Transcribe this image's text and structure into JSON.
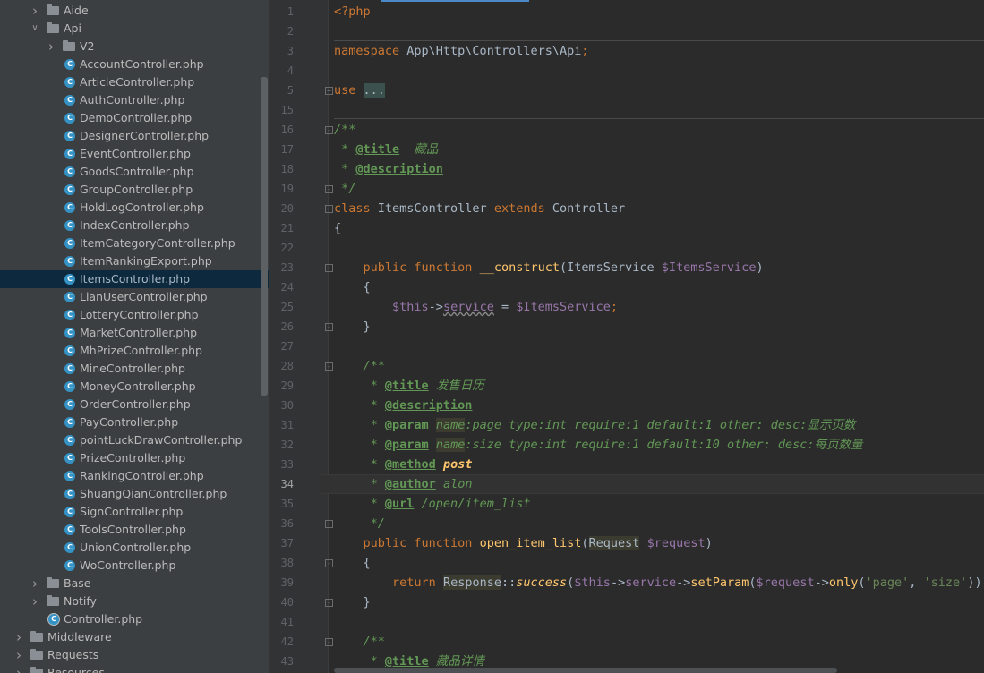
{
  "sidebar": {
    "tree": [
      {
        "label": "Aide",
        "kind": "folder",
        "level": 2,
        "expanded": false
      },
      {
        "label": "Api",
        "kind": "folder",
        "level": 2,
        "expanded": true
      },
      {
        "label": "V2",
        "kind": "folder",
        "level": 3,
        "expanded": false
      },
      {
        "label": "AccountController.php",
        "kind": "class",
        "level": 4
      },
      {
        "label": "ArticleController.php",
        "kind": "class",
        "level": 4
      },
      {
        "label": "AuthController.php",
        "kind": "class",
        "level": 4
      },
      {
        "label": "DemoController.php",
        "kind": "class",
        "level": 4
      },
      {
        "label": "DesignerController.php",
        "kind": "class",
        "level": 4
      },
      {
        "label": "EventController.php",
        "kind": "class",
        "level": 4
      },
      {
        "label": "GoodsController.php",
        "kind": "class",
        "level": 4
      },
      {
        "label": "GroupController.php",
        "kind": "class",
        "level": 4
      },
      {
        "label": "HoldLogController.php",
        "kind": "class",
        "level": 4
      },
      {
        "label": "IndexController.php",
        "kind": "class",
        "level": 4
      },
      {
        "label": "ItemCategoryController.php",
        "kind": "class",
        "level": 4
      },
      {
        "label": "ItemRankingExport.php",
        "kind": "class",
        "level": 4
      },
      {
        "label": "ItemsController.php",
        "kind": "class",
        "level": 4,
        "selected": true
      },
      {
        "label": "LianUserController.php",
        "kind": "class",
        "level": 4
      },
      {
        "label": "LotteryController.php",
        "kind": "class",
        "level": 4
      },
      {
        "label": "MarketController.php",
        "kind": "class",
        "level": 4
      },
      {
        "label": "MhPrizeController.php",
        "kind": "class",
        "level": 4
      },
      {
        "label": "MineController.php",
        "kind": "class",
        "level": 4
      },
      {
        "label": "MoneyController.php",
        "kind": "class",
        "level": 4
      },
      {
        "label": "OrderController.php",
        "kind": "class",
        "level": 4
      },
      {
        "label": "PayController.php",
        "kind": "class",
        "level": 4
      },
      {
        "label": "pointLuckDrawController.php",
        "kind": "class",
        "level": 4
      },
      {
        "label": "PrizeController.php",
        "kind": "class",
        "level": 4
      },
      {
        "label": "RankingController.php",
        "kind": "class",
        "level": 4
      },
      {
        "label": "ShuangQianController.php",
        "kind": "class",
        "level": 4
      },
      {
        "label": "SignController.php",
        "kind": "class",
        "level": 4
      },
      {
        "label": "ToolsController.php",
        "kind": "class",
        "level": 4
      },
      {
        "label": "UnionController.php",
        "kind": "class",
        "level": 4
      },
      {
        "label": "WoController.php",
        "kind": "class",
        "level": 4
      },
      {
        "label": "Base",
        "kind": "folder",
        "level": 2,
        "expanded": false
      },
      {
        "label": "Notify",
        "kind": "folder",
        "level": 2,
        "expanded": false
      },
      {
        "label": "Controller.php",
        "kind": "class-ring",
        "level": 3
      },
      {
        "label": "Middleware",
        "kind": "folder",
        "level": 1,
        "expanded": false
      },
      {
        "label": "Requests",
        "kind": "folder",
        "level": 1,
        "expanded": false
      },
      {
        "label": "Resources",
        "kind": "folder",
        "level": 1,
        "expanded": false
      }
    ]
  },
  "editor": {
    "current_line": "34",
    "lines": [
      {
        "n": "1",
        "html": "<span class='k'>&lt;?php</span>"
      },
      {
        "n": "2",
        "html": ""
      },
      {
        "n": "3",
        "html": "<span class='k'>namespace</span> App\\Http\\Controllers\\Api<span class='k'>;</span>"
      },
      {
        "n": "4",
        "html": ""
      },
      {
        "n": "5",
        "html": "<span class='k'>use</span> <span class='fmark'>...</span>"
      },
      {
        "n": "15",
        "html": ""
      },
      {
        "n": "16",
        "html": "<span class='c'>/**</span>"
      },
      {
        "n": "17",
        "html": "<span class='c'> * </span><span class='ct'>@title</span><span class='c'>  藏品</span>"
      },
      {
        "n": "18",
        "html": "<span class='c'> * </span><span class='ct'>@description</span>"
      },
      {
        "n": "19",
        "html": "<span class='c'> */</span>"
      },
      {
        "n": "20",
        "html": "<span class='k'>class</span> ItemsController <span class='k'>extends</span> Controller"
      },
      {
        "n": "21",
        "html": "{"
      },
      {
        "n": "22",
        "html": ""
      },
      {
        "n": "23",
        "html": "    <span class='k'>public function</span> <span class='f'>__construct</span>(ItemsService <span class='v'>$ItemsService</span>)"
      },
      {
        "n": "24",
        "html": "    {"
      },
      {
        "n": "25",
        "html": "        <span class='v'>$this</span>-&gt;<span class='v' style='text-decoration:underline wavy #8a8a8a'>service</span> = <span class='v'>$ItemsService</span><span class='k'>;</span>"
      },
      {
        "n": "26",
        "html": "    }"
      },
      {
        "n": "27",
        "html": ""
      },
      {
        "n": "28",
        "html": "    <span class='c'>/**</span>"
      },
      {
        "n": "29",
        "html": "<span class='c'>     * </span><span class='ct'>@title</span><span class='c'> 发售日历</span>"
      },
      {
        "n": "30",
        "html": "<span class='c'>     * </span><span class='ct'>@description</span>"
      },
      {
        "n": "31",
        "html": "<span class='c'>     * </span><span class='ct'>@param</span><span class='c'> </span><span class='c hl'>name</span><span class='c'>:page type:int require:1 default:1 other: desc:显示页数</span>"
      },
      {
        "n": "32",
        "html": "<span class='c'>     * </span><span class='ct'>@param</span><span class='c'> </span><span class='c hl'>name</span><span class='c'>:size type:int require:1 default:10 other: desc:每页数量</span>"
      },
      {
        "n": "33",
        "html": "<span class='c'>     * </span><span class='ct'>@method</span><span class='c'> </span><span class='fi' style='font-weight:bold'>post</span>"
      },
      {
        "n": "34",
        "html": "<span class='c'>     * </span><span class='ct'>@author</span><span class='c'> alon</span>"
      },
      {
        "n": "35",
        "html": "<span class='c'>     * </span><span class='ct'>@url</span><span class='c'> /open/item_list</span>"
      },
      {
        "n": "36",
        "html": "<span class='c'>     */</span>"
      },
      {
        "n": "37",
        "html": "    <span class='k'>public function</span> <span class='f'>open_item_list</span>(<span class='hl'>Request</span> <span class='v'>$request</span>)"
      },
      {
        "n": "38",
        "html": "    {"
      },
      {
        "n": "39",
        "html": "        <span class='k'>return</span> <span class='hl'>Response</span>::<span class='fi'>success</span>(<span class='v'>$this</span>-&gt;<span class='v'>service</span>-&gt;<span class='f'>setParam</span>(<span class='v'>$request</span>-&gt;<span class='f'>only</span>(<span class='s'>'page'</span>, <span class='s'>'size'</span>))-&gt;"
      },
      {
        "n": "40",
        "html": "    }"
      },
      {
        "n": "41",
        "html": ""
      },
      {
        "n": "42",
        "html": "    <span class='c'>/**</span>"
      },
      {
        "n": "43",
        "html": "<span class='c'>     * </span><span class='ct'>@title</span><span class='c'> 藏品详情</span>"
      }
    ]
  }
}
